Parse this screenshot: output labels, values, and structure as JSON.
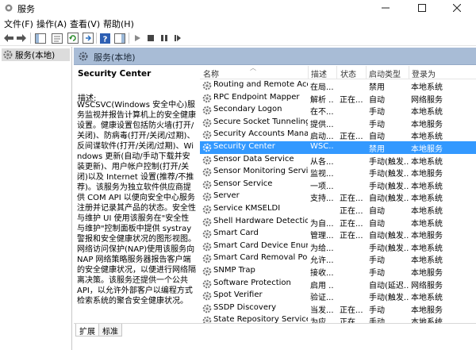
{
  "window": {
    "title": "服务"
  },
  "menu": [
    "文件(F)",
    "操作(A)",
    "查看(V)",
    "帮助(H)"
  ],
  "tree": {
    "item": "服务(本地)"
  },
  "header": {
    "title": "服务(本地)"
  },
  "description": {
    "service_name": "Security Center",
    "label": "描述:",
    "text": "WSCSVC(Windows 安全中心)服务监视并报告计算机上的安全健康设置。健康设置包括防火墙(打开/关闭)、防病毒(打开/关闭/过期)、反间谍软件(打开/关闭/过期)、Windows 更新(自动/手动下载并安装更新)、用户帐户控制(打开/关闭)以及 Internet 设置(推荐/不推荐)。该服务为独立软件供应商提供 COM API 以便向安全中心服务注册并记录其产品的状态。安全性与维护 UI 使用该服务在\"安全性与维护\"控制面板中提供 systray 警报和安全健康状况的图形视图。网络访问保护(NAP)使用该服务向 NAP 网络策略服务器报告客户端的安全健康状况，以便进行网络隔离决策。该服务还提供一个公共 API，以允许外部客户以编程方式检索系统的聚合安全健康状况。"
  },
  "columns": {
    "name": "名称",
    "desc": "描述",
    "status": "状态",
    "startup": "启动类型",
    "logon": "登录为"
  },
  "rows": [
    {
      "name": "Routing and Remote Acc...",
      "desc": "在局...",
      "status": "",
      "startup": "禁用",
      "logon": "本地系统"
    },
    {
      "name": "RPC Endpoint Mapper",
      "desc": "解析 ...",
      "status": "正在...",
      "startup": "自动",
      "logon": "网络服务"
    },
    {
      "name": "Secondary Logon",
      "desc": "在不...",
      "status": "",
      "startup": "手动",
      "logon": "本地系统"
    },
    {
      "name": "Secure Socket Tunneling ...",
      "desc": "提供...",
      "status": "",
      "startup": "手动",
      "logon": "本地服务"
    },
    {
      "name": "Security Accounts Mana...",
      "desc": "启动...",
      "status": "正在...",
      "startup": "自动",
      "logon": "本地系统"
    },
    {
      "name": "Security Center",
      "desc": "WSC...",
      "status": "",
      "startup": "禁用",
      "logon": "本地服务"
    },
    {
      "name": "Sensor Data Service",
      "desc": "从各...",
      "status": "",
      "startup": "手动(触发...",
      "logon": "本地系统"
    },
    {
      "name": "Sensor Monitoring Service",
      "desc": "监视...",
      "status": "",
      "startup": "手动(触发...",
      "logon": "本地服务"
    },
    {
      "name": "Sensor Service",
      "desc": "一项...",
      "status": "",
      "startup": "手动(触发...",
      "logon": "本地系统"
    },
    {
      "name": "Server",
      "desc": "支持...",
      "status": "正在...",
      "startup": "自动(触发...",
      "logon": "本地系统"
    },
    {
      "name": "Service KMSELDI",
      "desc": "",
      "status": "正在...",
      "startup": "自动",
      "logon": "本地系统"
    },
    {
      "name": "Shell Hardware Detection",
      "desc": "为自...",
      "status": "正在...",
      "startup": "自动",
      "logon": "本地系统"
    },
    {
      "name": "Smart Card",
      "desc": "管理...",
      "status": "正在...",
      "startup": "自动(触发...",
      "logon": "本地服务"
    },
    {
      "name": "Smart Card Device Enum...",
      "desc": "为给...",
      "status": "",
      "startup": "手动(触发...",
      "logon": "本地系统"
    },
    {
      "name": "Smart Card Removal Poli...",
      "desc": "允许...",
      "status": "",
      "startup": "手动",
      "logon": "本地系统"
    },
    {
      "name": "SNMP Trap",
      "desc": "接收...",
      "status": "",
      "startup": "手动",
      "logon": "本地服务"
    },
    {
      "name": "Software Protection",
      "desc": "启用 ...",
      "status": "",
      "startup": "自动(延迟...",
      "logon": "网络服务"
    },
    {
      "name": "Spot Verifier",
      "desc": "验证...",
      "status": "",
      "startup": "手动(触发...",
      "logon": "本地系统"
    },
    {
      "name": "SSDP Discovery",
      "desc": "当发...",
      "status": "正在...",
      "startup": "手动",
      "logon": "本地服务"
    },
    {
      "name": "State Repository Service",
      "desc": "为应...",
      "status": "正在...",
      "startup": "手动",
      "logon": "本地系统"
    }
  ],
  "selected_row": 5,
  "tabs": [
    "扩展",
    "标准"
  ],
  "colors": {
    "selection": "#3399ff",
    "header_band": "#a8bcd6"
  }
}
